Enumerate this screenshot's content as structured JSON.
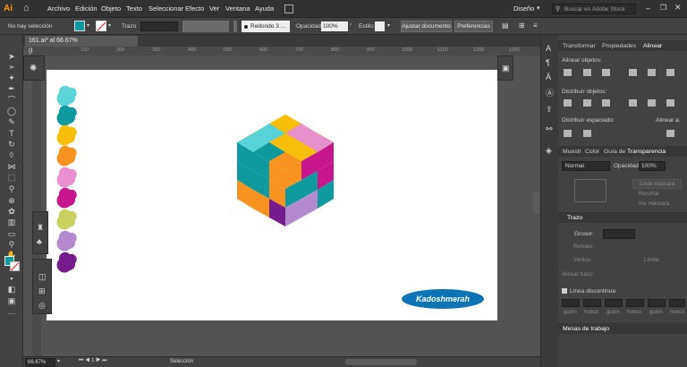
{
  "menubar": {
    "logo": "Ai",
    "items": [
      "Archivo",
      "Edición",
      "Objeto",
      "Texto",
      "Seleccionar",
      "Efecto",
      "Ver",
      "Ventana",
      "Ayuda"
    ],
    "workspace": "Diseño",
    "search_placeholder": "Buscar en Adobe Stock"
  },
  "control": {
    "selection": "No hay selección",
    "stroke_label": "Trazo",
    "brush": "Redondo 3 ...",
    "opacity_label": "Opacidad:",
    "opacity_value": "100%",
    "style_label": "Estilo:",
    "fit_doc": "Ajustar documento",
    "prefs": "Preferencias",
    "fill_color": "#0e9a9f"
  },
  "document": {
    "tab_title": "161.ai* al 66.67% (RGB/Previsualizar)",
    "ruler_ticks": [
      "100",
      "200",
      "300",
      "400",
      "500",
      "600",
      "700",
      "800",
      "900",
      "1000",
      "1100",
      "1200",
      "1300"
    ],
    "zoom": "66.67%",
    "tool_status": "Selección"
  },
  "artwork": {
    "watermark": "Kadoshmerah",
    "watermark_color": "#0c73b4",
    "swatches": [
      "#5ad3d9",
      "#0e9a9f",
      "#f7bf0a",
      "#f7931e",
      "#ea8fcf",
      "#c8168f",
      "#c9d15f",
      "#b38ad0",
      "#751b8c"
    ],
    "cube_colors": {
      "top": [
        "#f7bf0a",
        "#e691cc",
        "#56d3d8",
        "#f7bf0a",
        "#c8168f",
        "#f7931e"
      ]
    }
  },
  "right_panel": {
    "tabs": [
      "Transformar",
      "Propiedades",
      "Alinear"
    ],
    "align_objects": "Alinear objetos:",
    "distribute_objects": "Distribuir objetos:",
    "distribute_spacing": "Distribuir espaciado:",
    "align_to": "Alinear a:",
    "tabs2": [
      "Muestr",
      "Color",
      "Guía de",
      "Transparencia"
    ],
    "blend_mode": "Normal",
    "opacity_label": "Opacidad:",
    "opacity_value": "100%",
    "mask_btn": "Crear máscara",
    "clip": "Recortar",
    "invert": "Inv. máscara",
    "stroke_title": "Trazo",
    "weight": "Grosor:",
    "cap": "Remate:",
    "corner": "Vértice:",
    "limit": "Límite:",
    "align_stroke": "Alinear trazo:",
    "dashed": "Línea discontinua",
    "dash_labels": [
      "guión",
      "hueco",
      "guión",
      "hueco",
      "guión",
      "hueco"
    ],
    "artboards": "Mesas de trabajo"
  }
}
